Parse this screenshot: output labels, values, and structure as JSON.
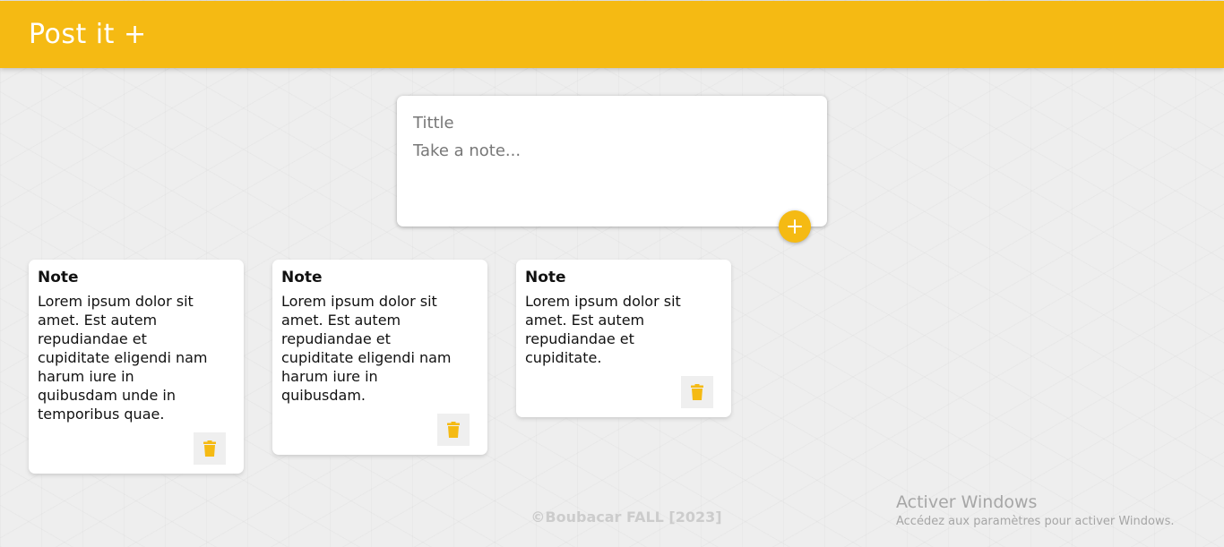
{
  "header": {
    "title": "Post it +"
  },
  "create_note": {
    "title_placeholder": "Tittle",
    "content_placeholder": "Take a note...",
    "add_icon": "plus-icon"
  },
  "notes": [
    {
      "title": "Note",
      "content": "Lorem ipsum dolor sit\namet. Est autem\nrepudiandae et\ncupiditate eligendi nam\nharum iure in\nquibusdam unde in\ntemporibus quae.",
      "delete_icon": "trash-icon"
    },
    {
      "title": "Note",
      "content": "Lorem ipsum dolor sit\namet. Est autem\nrepudiandae et\ncupiditate eligendi nam\nharum iure in\nquibusdam.",
      "delete_icon": "trash-icon"
    },
    {
      "title": "Note",
      "content": "Lorem ipsum dolor sit\namet. Est autem\nrepudiandae et\ncupiditate.",
      "delete_icon": "trash-icon"
    }
  ],
  "footer": {
    "text": "©Boubacar FALL [2023]"
  },
  "watermark": {
    "title": "Activer Windows",
    "subtitle": "Accédez aux paramètres pour activer Windows."
  },
  "colors": {
    "accent": "#f5ba13",
    "background": "#eeeeee",
    "card": "#ffffff"
  }
}
